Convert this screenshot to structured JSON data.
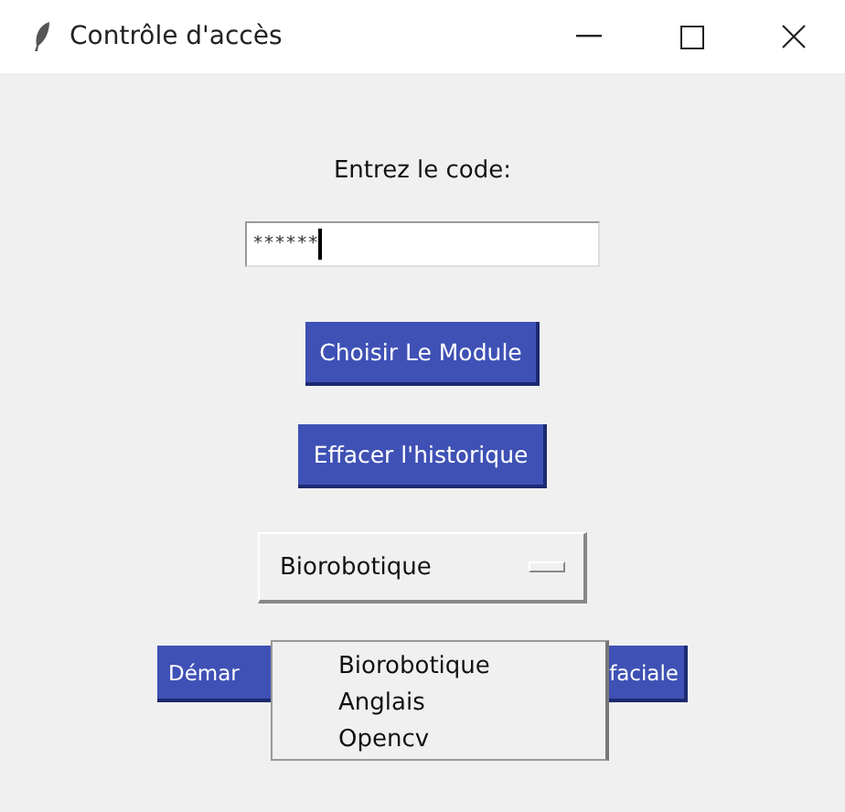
{
  "window": {
    "title": "Contrôle d'accès"
  },
  "prompt": "Entrez le code:",
  "code_field": {
    "value": "******"
  },
  "buttons": [
    "Choisir Le Module",
    "Effacer l'historique"
  ],
  "module_select": {
    "value": "Biorobotique",
    "expanded": true,
    "options": [
      {
        "label": "Biorobotique"
      },
      {
        "label": "Anglais"
      },
      {
        "label": "Opencv"
      }
    ]
  },
  "start_button": {
    "label_start": "Démar",
    "label_end": "faciale"
  }
}
